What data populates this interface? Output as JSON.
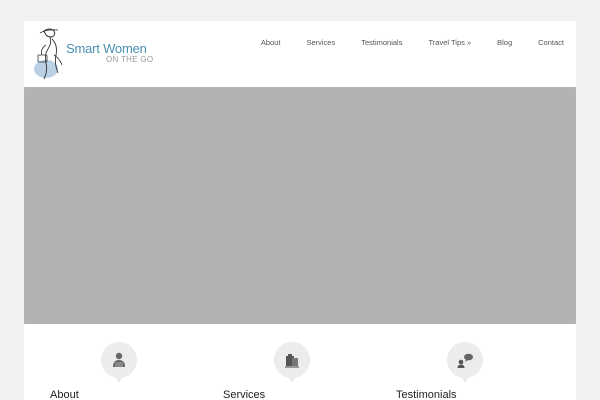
{
  "header": {
    "logo": {
      "line1": "Smart Women",
      "line2": "ON THE GO"
    },
    "nav": [
      {
        "label": "About"
      },
      {
        "label": "Services"
      },
      {
        "label": "Testimonials"
      },
      {
        "label": "Travel Tips »"
      },
      {
        "label": "Blog"
      },
      {
        "label": "Contact"
      }
    ]
  },
  "hero": {
    "background": "#b5b5b5"
  },
  "features": [
    {
      "title": "About",
      "icon": "woman-icon"
    },
    {
      "title": "Services",
      "icon": "luggage-icon"
    },
    {
      "title": "Testimonials",
      "icon": "speech-bubbles-icon"
    }
  ],
  "colors": {
    "brand": "#4a90b2",
    "page_bg": "#f1f1f1",
    "icon_circle": "#ececec"
  }
}
